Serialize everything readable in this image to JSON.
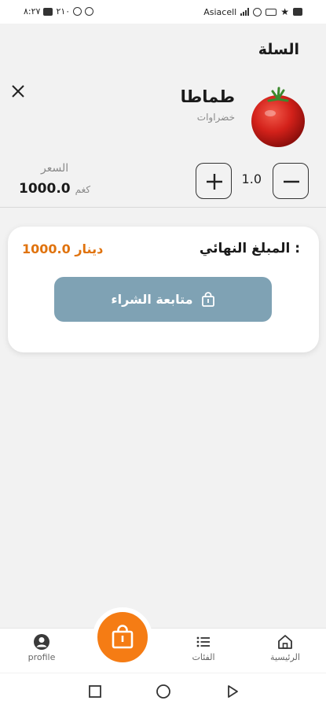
{
  "status_bar": {
    "time": "٨:٢٧",
    "speed": "٢١٠",
    "carrier": "Asiacell"
  },
  "header": {
    "title": "السلة"
  },
  "cart_item": {
    "name": "طماطا",
    "category": "خضراوات",
    "quantity": "1.0",
    "price_label": "السعر",
    "price": "1000.0",
    "price_unit": "كغم"
  },
  "summary": {
    "total_label": "المبلغ النهائي :",
    "total_amount": "1000.0 دينار",
    "checkout_label": "متابعة الشراء"
  },
  "bottom_nav": {
    "items": [
      {
        "label": "profile",
        "icon": "profile-icon"
      },
      {
        "label": "الفئات",
        "icon": "list-icon"
      },
      {
        "label": "الرئيسية",
        "icon": "home-icon"
      }
    ],
    "fab_icon": "shopping-bag-icon"
  },
  "colors": {
    "accent": "#f57c14",
    "total_text": "#e0730e",
    "checkout_button": "#7fa2b4",
    "background": "#f2f2f2"
  }
}
